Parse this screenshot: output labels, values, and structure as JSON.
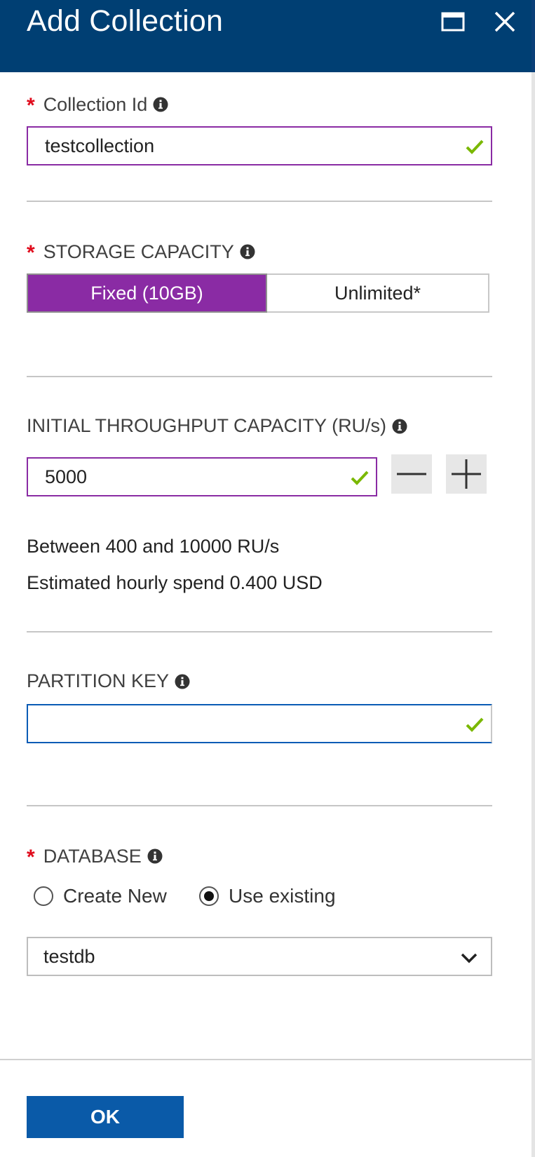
{
  "colors": {
    "header_bg": "#003f73",
    "accent_purple": "#8a2ba4",
    "required_red": "#e00b1c",
    "valid_green": "#7ab800",
    "ok_button_bg": "#0a5aa8"
  },
  "header": {
    "title": "Add Collection",
    "maximize_icon": "maximize-icon",
    "close_icon": "close-icon"
  },
  "collection_id": {
    "required_mark": "*",
    "label": "Collection Id",
    "value": "testcollection",
    "info_icon": "info-icon",
    "valid": true
  },
  "storage_capacity": {
    "required_mark": "*",
    "label": "STORAGE CAPACITY",
    "options": [
      "Fixed (10GB)",
      "Unlimited*"
    ],
    "selected": "Fixed (10GB)"
  },
  "throughput": {
    "label": "INITIAL THROUGHPUT CAPACITY (RU/s)",
    "value": "5000",
    "range_text": "Between 400 and 10000 RU/s",
    "spend_text": "Estimated hourly spend 0.400 USD",
    "decrease_icon": "minus-icon",
    "increase_icon": "plus-icon"
  },
  "partition_key": {
    "label": "PARTITION KEY",
    "value": "",
    "valid": true
  },
  "database": {
    "required_mark": "*",
    "label": "DATABASE",
    "options": [
      "Create New",
      "Use existing"
    ],
    "selected_option": "Use existing",
    "selected_value": "testdb",
    "dropdown_icon": "chevron-down-icon"
  },
  "footer": {
    "ok_label": "OK"
  }
}
